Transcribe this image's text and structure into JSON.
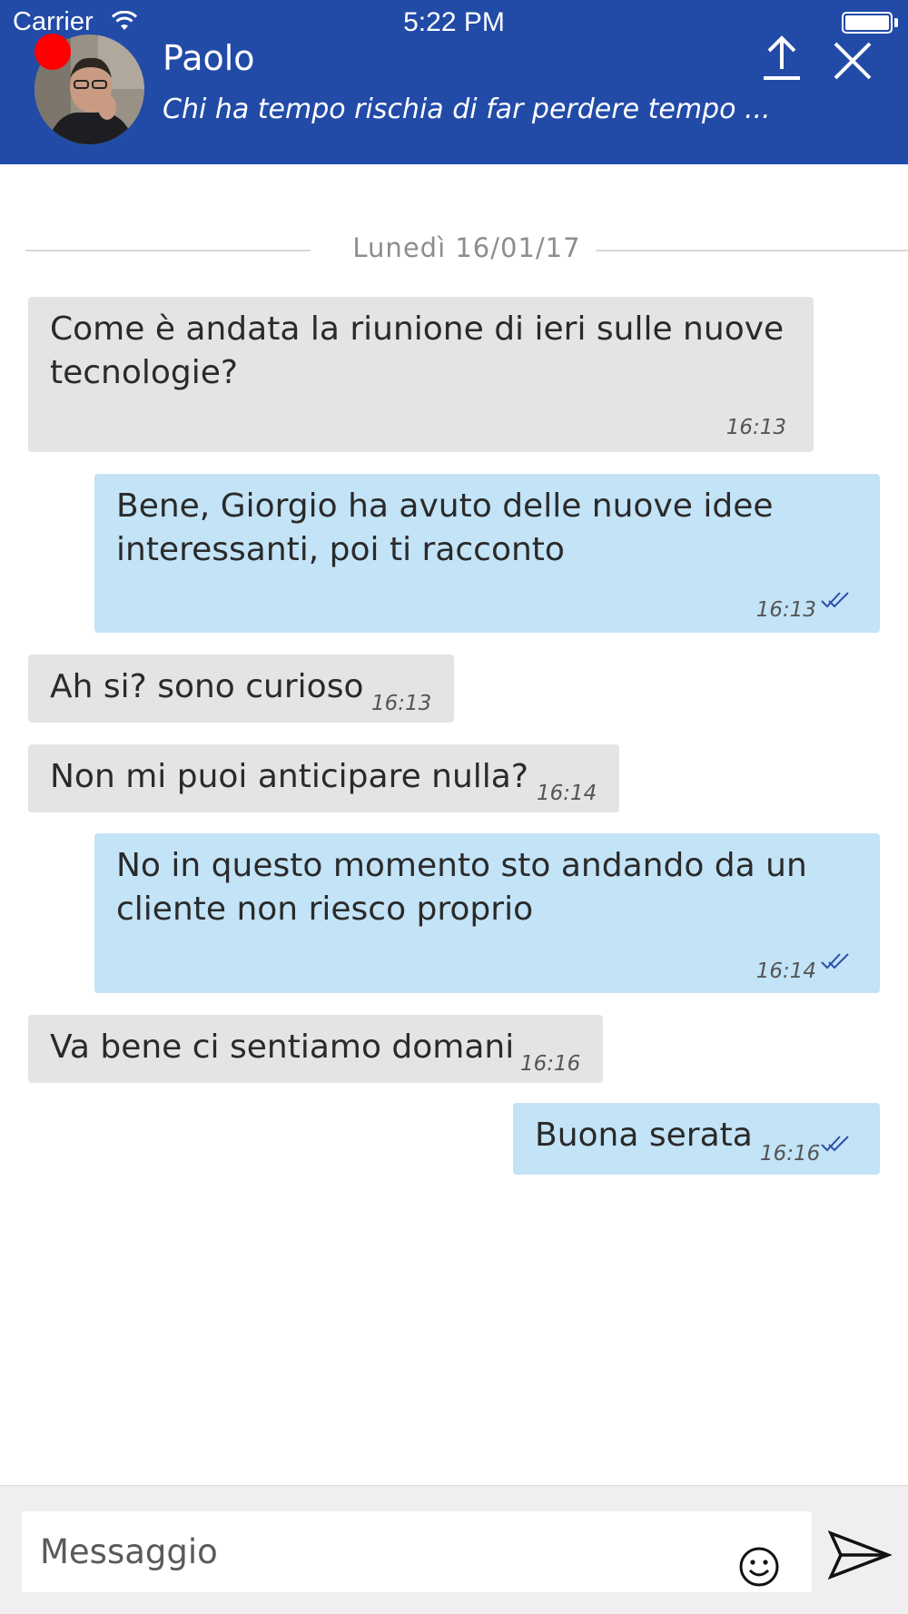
{
  "status_bar": {
    "carrier": "Carrier",
    "time": "5:22 PM"
  },
  "header": {
    "contact_name": "Paolo",
    "contact_status": "Chi ha tempo rischia di far perdere tempo ...",
    "presence_color": "#ff0000",
    "background_color": "#224ba8",
    "upload_icon": "upload-icon",
    "close_icon": "close-icon"
  },
  "chat": {
    "day_label": "Lunedì 16/01/17",
    "incoming_color": "#e4e4e6",
    "outgoing_color": "#c3e3f7",
    "messages": [
      {
        "direction": "in",
        "text": "Come è andata la riunione di ieri sulle nuove\ntecnologie?",
        "time": "16:13"
      },
      {
        "direction": "out",
        "text": "Bene, Giorgio ha avuto delle nuove idee\ninteressanti, poi ti racconto",
        "time": "16:13",
        "read": true
      },
      {
        "direction": "in",
        "text": "Ah si? sono curioso",
        "time": "16:13"
      },
      {
        "direction": "in",
        "text": "Non mi puoi anticipare nulla?",
        "time": "16:14"
      },
      {
        "direction": "out",
        "text": "No in questo momento sto andando da un\ncliente non riesco proprio",
        "time": "16:14",
        "read": true
      },
      {
        "direction": "in",
        "text": "Va bene ci sentiamo domani",
        "time": "16:16"
      },
      {
        "direction": "out",
        "text": "Buona serata",
        "time": "16:16",
        "read": true
      }
    ]
  },
  "composer": {
    "placeholder": "Messaggio",
    "emoji_icon": "smiley-icon",
    "send_icon": "send-icon"
  }
}
